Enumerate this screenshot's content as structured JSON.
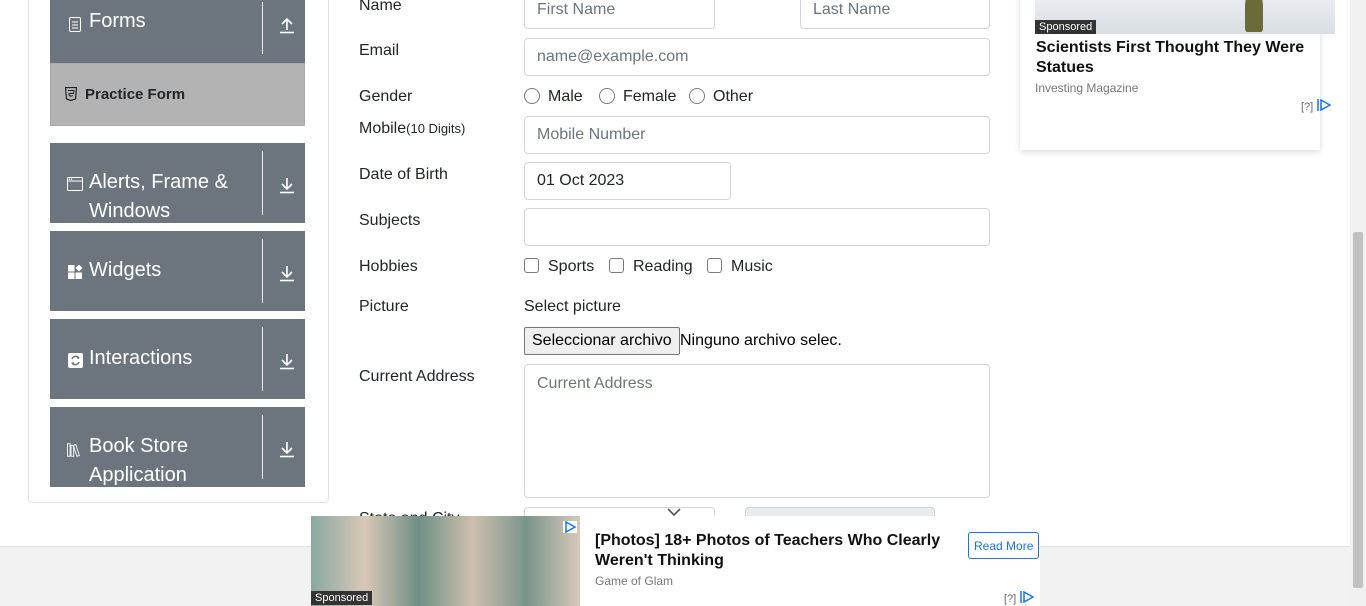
{
  "sidebar": {
    "groups": [
      {
        "label": "Forms",
        "icon": "document-icon",
        "arrow": "upload-arrow-icon"
      },
      {
        "label": "Alerts, Frame &",
        "label2": "Windows",
        "icon": "window-icon",
        "arrow": "download-arrow-icon"
      },
      {
        "label": "Widgets",
        "icon": "widgets-icon",
        "arrow": "download-arrow-icon"
      },
      {
        "label": "Interactions",
        "icon": "interactions-icon",
        "arrow": "download-arrow-icon"
      },
      {
        "label": "Book Store",
        "label2": "Application",
        "icon": "books-icon",
        "arrow": "download-arrow-icon"
      }
    ],
    "active_item": {
      "label": "Practice Form",
      "icon": "html5-icon"
    }
  },
  "form": {
    "name_label": "Name",
    "first_name_placeholder": "First Name",
    "last_name_placeholder": "Last Name",
    "email_label": "Email",
    "email_placeholder": "name@example.com",
    "gender_label": "Gender",
    "gender_options": [
      "Male",
      "Female",
      "Other"
    ],
    "mobile_label": "Mobile",
    "mobile_hint": "(10 Digits)",
    "mobile_placeholder": "Mobile Number",
    "dob_label": "Date of Birth",
    "dob_value": "01 Oct 2023",
    "subjects_label": "Subjects",
    "hobbies_label": "Hobbies",
    "hobby_options": [
      "Sports",
      "Reading",
      "Music"
    ],
    "picture_label": "Picture",
    "select_picture_label": "Select picture",
    "file_button": "Seleccionar archivo",
    "file_status": "Ninguno archivo selec.",
    "address_label": "Current Address",
    "address_placeholder": "Current Address",
    "state_city_label": "State and City"
  },
  "right_ad": {
    "sponsored": "Sponsored",
    "headline": "Scientists First Thought They Were Statues",
    "source": "Investing Magazine",
    "adchoice": "[?]"
  },
  "bottom_ad": {
    "sponsored": "Sponsored",
    "headline": "[Photos] 18+ Photos of Teachers Who Clearly Weren't Thinking",
    "source": "Game of Glam",
    "cta": "Read More",
    "adchoice": "[?]"
  },
  "colors": {
    "sidebar_group": "#6c757d",
    "active_item": "#b3b3b3",
    "input_border": "#ced4da",
    "ad_accent": "#1a73e8"
  }
}
